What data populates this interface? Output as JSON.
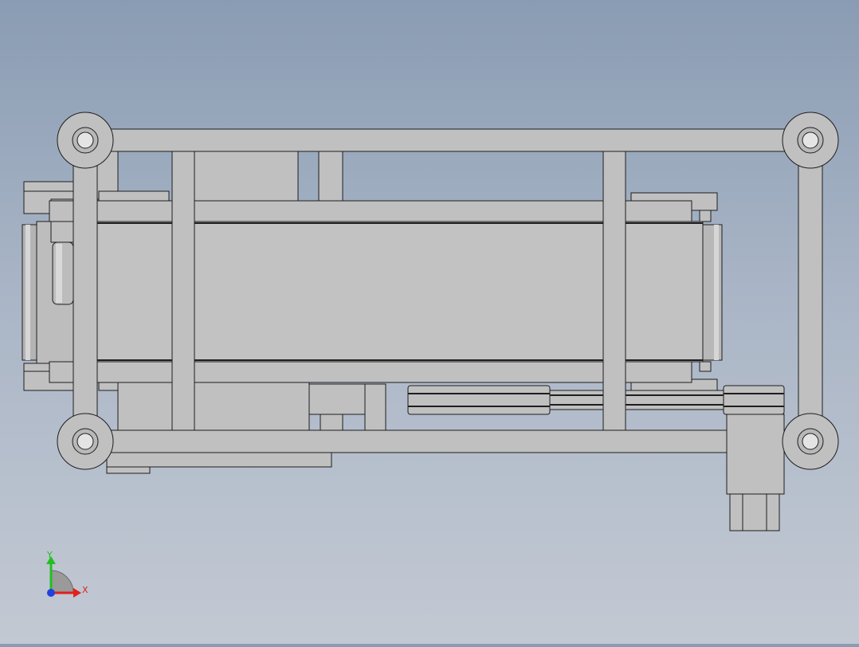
{
  "viewport": {
    "background_top": "#8a9cb3",
    "background_bottom": "#c3c9d3",
    "part_fill": "#c0c0c0",
    "part_edge": "#1e1e1e"
  },
  "triad": {
    "x_label": "X",
    "y_label": "Y",
    "x_color": "#e02020",
    "y_color": "#20c020",
    "z_color": "#2040e0"
  }
}
